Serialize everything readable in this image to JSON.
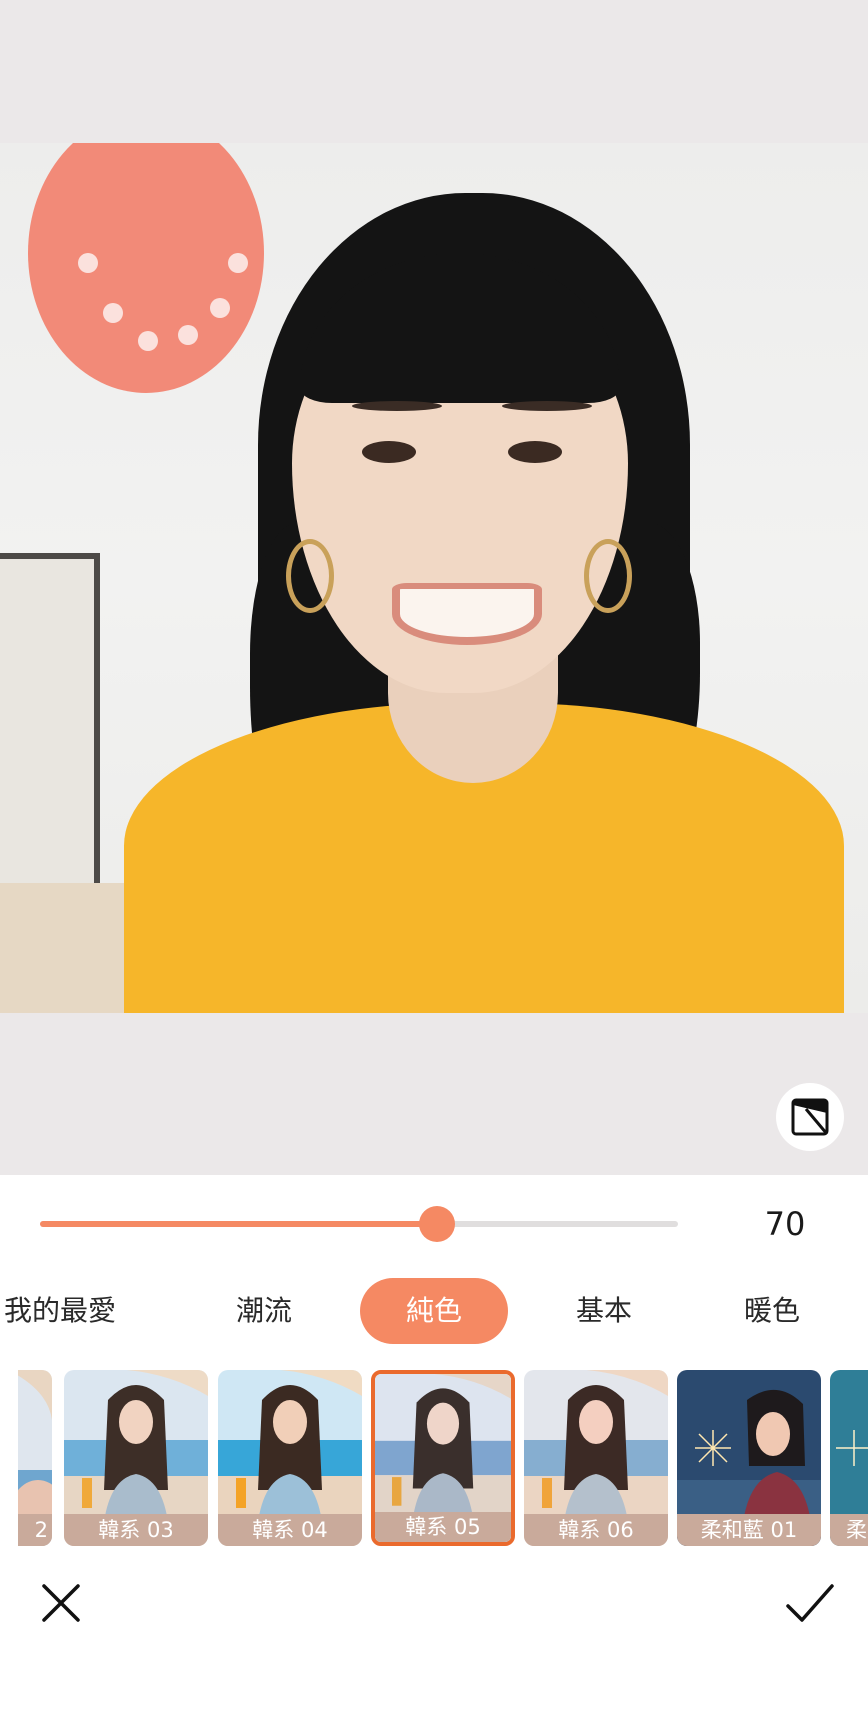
{
  "editor": {
    "compare_icon": "compare-icon",
    "intensity": {
      "value": 70,
      "max": 100,
      "label": "70",
      "accent": "#f58963"
    }
  },
  "tabs": [
    {
      "label": "我的最愛",
      "active": false
    },
    {
      "label": "潮流",
      "active": false
    },
    {
      "label": "純色",
      "active": true
    },
    {
      "label": "基本",
      "active": false
    },
    {
      "label": "暖色",
      "active": false
    }
  ],
  "filters": [
    {
      "label": "2",
      "selected": false
    },
    {
      "label": "韓系 03",
      "selected": false
    },
    {
      "label": "韓系 04",
      "selected": false
    },
    {
      "label": "韓系 05",
      "selected": true
    },
    {
      "label": "韓系 06",
      "selected": false
    },
    {
      "label": "柔和藍 01",
      "selected": false
    },
    {
      "label": "柔",
      "selected": false
    }
  ],
  "actions": {
    "cancel_icon": "close-icon",
    "confirm_icon": "checkmark-icon"
  }
}
